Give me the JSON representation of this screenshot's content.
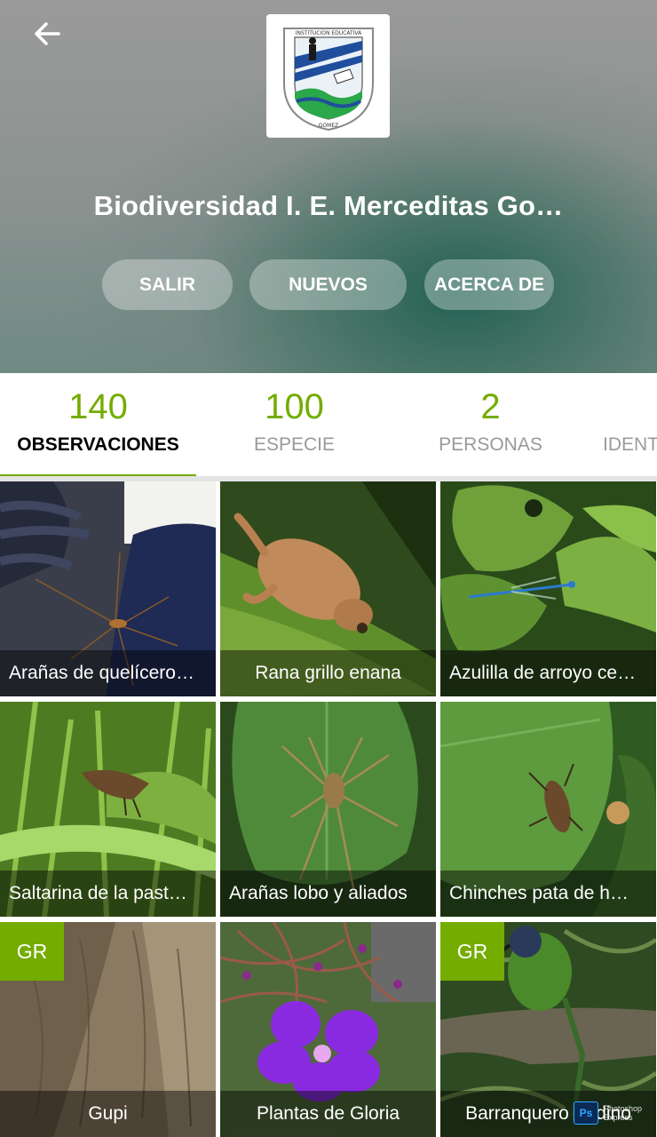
{
  "header": {
    "back_icon": "arrow-left-icon",
    "logo": {
      "icon": "school-shield-logo",
      "text_top": "INSTITUCION EDUCATIVA",
      "text_bottom": "GOMEZ"
    },
    "title": "Biodiversidad I. E. Merceditas Go…",
    "buttons": [
      {
        "label": "SALIR"
      },
      {
        "label": "NUEVOS"
      },
      {
        "label": "ACERCA DE"
      }
    ]
  },
  "stats_tabs": [
    {
      "count": "140",
      "label": "OBSERVACIONES",
      "active": true
    },
    {
      "count": "100",
      "label": "ESPECIE",
      "active": false
    },
    {
      "count": "2",
      "label": "PERSONAS",
      "active": false
    },
    {
      "count": "",
      "label": "IDENT",
      "active": false
    }
  ],
  "observations": [
    {
      "caption": "Arañas de quelícero…",
      "badge": ""
    },
    {
      "caption": "Rana grillo enana",
      "badge": ""
    },
    {
      "caption": "Azulilla de arroyo ce…",
      "badge": ""
    },
    {
      "caption": "Saltarina de la past…",
      "badge": ""
    },
    {
      "caption": "Arañas lobo y aliados",
      "badge": ""
    },
    {
      "caption": "Chinches pata de h…",
      "badge": ""
    },
    {
      "caption": "Gupi",
      "badge": "GR"
    },
    {
      "caption": "Plantas de Gloria",
      "badge": ""
    },
    {
      "caption": "Barranquero Andino",
      "badge": "GR"
    }
  ],
  "watermark": {
    "icon": "photoshop-icon",
    "icon_text": "Ps",
    "line1": "Photoshop",
    "line2": "Express"
  },
  "colors": {
    "accent": "#74ac00",
    "caption_bg": "rgba(0,0,0,0.45)"
  }
}
